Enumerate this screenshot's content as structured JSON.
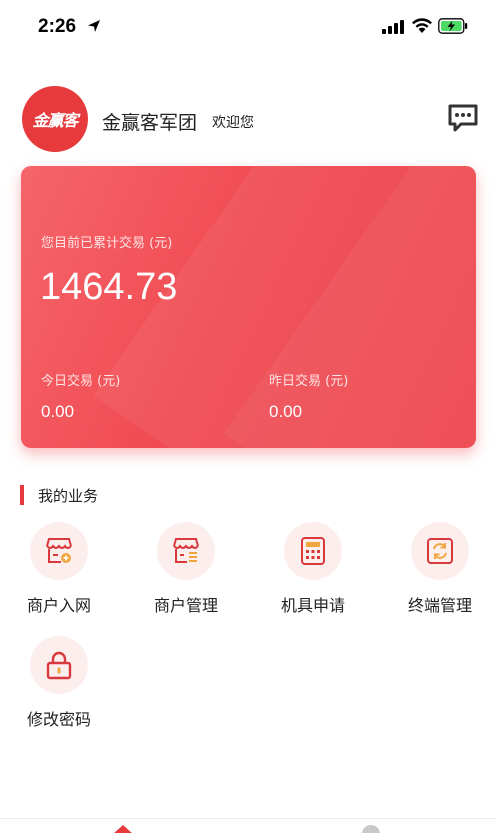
{
  "status_bar": {
    "time": "2:26"
  },
  "header": {
    "logo_text": "金赢客",
    "brand": "金赢客军团",
    "welcome": "欢迎您"
  },
  "card": {
    "total_label": "您目前已累计交易 (元)",
    "total_value": "1464.73",
    "today_label": "今日交易 (元)",
    "today_value": "0.00",
    "yesterday_label": "昨日交易 (元)",
    "yesterday_value": "0.00"
  },
  "section": {
    "title": "我的业务",
    "items": [
      {
        "label": "商户入网",
        "icon": "store-add-icon"
      },
      {
        "label": "商户管理",
        "icon": "store-manage-icon"
      },
      {
        "label": "机具申请",
        "icon": "calculator-icon"
      },
      {
        "label": "终端管理",
        "icon": "terminal-refresh-icon"
      },
      {
        "label": "修改密码",
        "icon": "lock-icon"
      }
    ]
  },
  "colors": {
    "accent": "#e63a3c",
    "card_start": "#f5656a",
    "card_end": "#ec3b44",
    "icon_bg": "#fdeeee"
  }
}
